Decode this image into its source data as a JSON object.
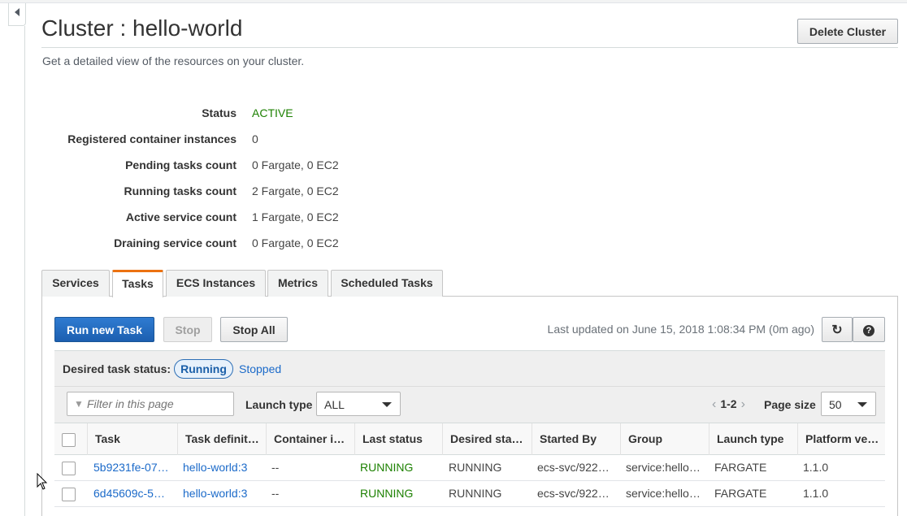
{
  "page": {
    "title": "Cluster : hello-world",
    "subtitle": "Get a detailed view of the resources on your cluster.",
    "delete_button": "Delete Cluster"
  },
  "details": [
    {
      "label": "Status",
      "value": "ACTIVE"
    },
    {
      "label": "Registered container instances",
      "value": "0"
    },
    {
      "label": "Pending tasks count",
      "value": "0 Fargate, 0 EC2"
    },
    {
      "label": "Running tasks count",
      "value": "2 Fargate, 0 EC2"
    },
    {
      "label": "Active service count",
      "value": "1 Fargate, 0 EC2"
    },
    {
      "label": "Draining service count",
      "value": "0 Fargate, 0 EC2"
    }
  ],
  "tabs": [
    {
      "label": "Services"
    },
    {
      "label": "Tasks",
      "active": true
    },
    {
      "label": "ECS Instances"
    },
    {
      "label": "Metrics"
    },
    {
      "label": "Scheduled Tasks"
    }
  ],
  "toolbar": {
    "run_new_task": "Run new Task",
    "stop": "Stop",
    "stop_all": "Stop All",
    "last_updated": "Last updated on June 15, 2018 1:08:34 PM (0m ago)"
  },
  "filters": {
    "desired_label": "Desired task status:",
    "running": "Running",
    "stopped": "Stopped",
    "filter_placeholder": "Filter in this page",
    "launch_type_label": "Launch type",
    "launch_type_value": "ALL",
    "page_range": "1-2",
    "page_size_label": "Page size",
    "page_size_value": "50"
  },
  "table": {
    "columns": [
      "Task",
      "Task definit…",
      "Container i…",
      "Last status",
      "Desired sta…",
      "Started By",
      "Group",
      "Launch type",
      "Platform ve…"
    ],
    "rows": [
      [
        "5b9231fe-07…",
        "hello-world:3",
        "--",
        "RUNNING",
        "RUNNING",
        "ecs-svc/922…",
        "service:hello…",
        "FARGATE",
        "1.1.0"
      ],
      [
        "6d45609c-5…",
        "hello-world:3",
        "--",
        "RUNNING",
        "RUNNING",
        "ecs-svc/922…",
        "service:hello…",
        "FARGATE",
        "1.1.0"
      ]
    ]
  },
  "colors": {
    "active_status": "#1d8102",
    "link": "#1b6ac9",
    "primary_button": "#1c5fb0",
    "tab_accent": "#ec7211"
  },
  "icons": [
    "collapse-sidebar-icon",
    "filter-icon",
    "refresh-icon",
    "help-icon",
    "chevron-left-icon",
    "chevron-right-icon",
    "caret-down-icon"
  ]
}
